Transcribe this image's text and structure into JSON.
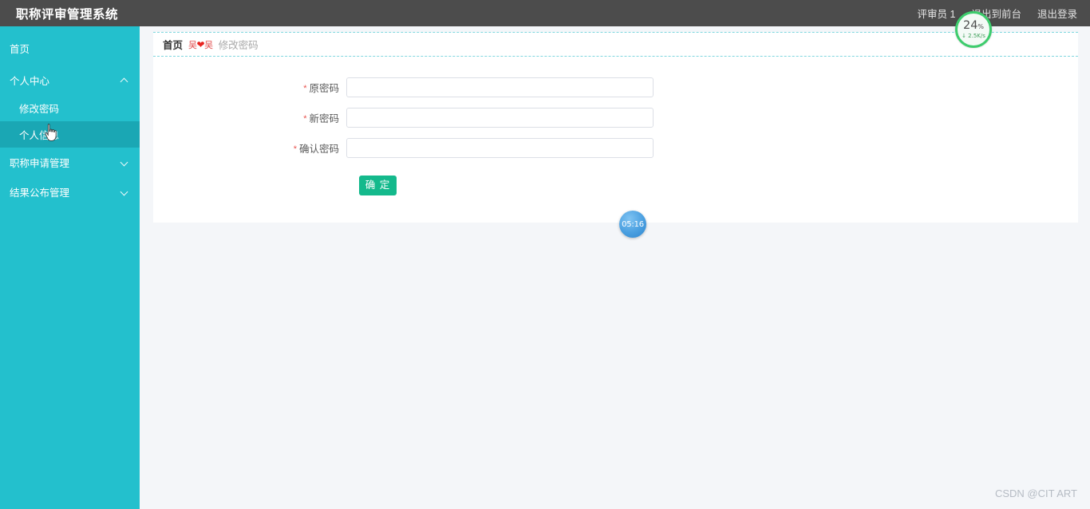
{
  "header": {
    "title": "职称评审管理系统",
    "user": "评审员 1",
    "exit_front_label": "退出到前台",
    "logout_label": "退出登录"
  },
  "sidebar": {
    "items": [
      {
        "label": "首页",
        "type": "link",
        "icon": "",
        "active": false
      },
      {
        "label": "个人中心",
        "type": "group",
        "icon": "chevron-up-icon",
        "active": false
      },
      {
        "label": "修改密码",
        "type": "sub",
        "icon": "",
        "active": false
      },
      {
        "label": "个人信息",
        "type": "sub",
        "icon": "",
        "active": true
      },
      {
        "label": "职称申请管理",
        "type": "group",
        "icon": "chevron-down-icon",
        "active": false
      },
      {
        "label": "结果公布管理",
        "type": "group",
        "icon": "chevron-down-icon",
        "active": false
      }
    ]
  },
  "breadcrumb": {
    "home": "首页",
    "separator": "吴",
    "separator_heart": "❤",
    "current": "修改密码"
  },
  "form": {
    "fields": [
      {
        "label": "原密码",
        "required": true,
        "value": "",
        "placeholder": ""
      },
      {
        "label": "新密码",
        "required": true,
        "value": "",
        "placeholder": ""
      },
      {
        "label": "确认密码",
        "required": true,
        "value": "",
        "placeholder": ""
      }
    ],
    "submit_label": "确 定"
  },
  "widgets": {
    "netmeter": {
      "percent": "24",
      "percent_unit": "%",
      "speed": "↓ 2.5K/s",
      "ring_color": "#3ecc6d"
    },
    "clock": {
      "time": "05:16"
    }
  },
  "watermark": "CSDN @CIT ART",
  "colors": {
    "topbar_bg": "#4c4c4c",
    "sidebar_bg": "#23c0cd",
    "sidebar_active": "#1aa7b4",
    "page_bg": "#f4f6f9",
    "accent_green": "#14b98c",
    "required_red": "#e8534f",
    "breadcrumb_dash": "#7fd6de"
  }
}
